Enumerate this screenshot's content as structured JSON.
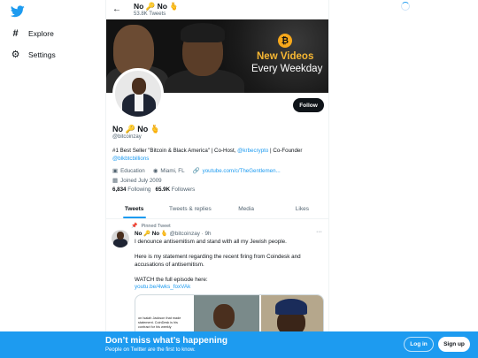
{
  "nav": {
    "logo_icon": "twitter-bird-icon",
    "items": [
      {
        "label": "Explore",
        "icon": "hashtag-icon"
      },
      {
        "label": "Settings",
        "icon": "gear-icon"
      }
    ]
  },
  "header": {
    "name": "No 🔑 No 🫰",
    "tweet_count": "53.8K Tweets"
  },
  "banner": {
    "line1": "New Videos",
    "line2": "Every Weekday"
  },
  "profile": {
    "name": "No 🔑 No 🫰",
    "handle": "@bitcoinzay",
    "bio_pre": "#1 Best Seller \"Bitcoin & Black America\" | Co-Host, ",
    "bio_link1": "@krbecrypto",
    "bio_mid": " | Co-Founder",
    "bio_link2": "@blkbtcbillions",
    "category": "Education",
    "location": "Miami, FL",
    "website": "youtube.com/c/TheGentlemen...",
    "joined": "Joined July 2009",
    "following_count": "6,834",
    "following_label": "Following",
    "followers_count": "65.9K",
    "followers_label": "Followers",
    "follow_button": "Follow"
  },
  "tabs": [
    "Tweets",
    "Tweets & replies",
    "Media",
    "Likes"
  ],
  "tweet": {
    "pinned_label": "Pinned Tweet",
    "name": "No 🔑 No 🫰",
    "handle": "@bitcoinzay",
    "time": "9h",
    "para1": "I denounce antisemitism and stand with all my Jewish people.",
    "para2": "Here is my statement regarding the recent firing from Coindesk and accusations of antisemitism.",
    "para3": "WATCH the full episode here:",
    "link": "youtu.be/4wks_foxVAk",
    "media_text": "on Isaiah Jackson that made statement. CoinDesk is his contract for his weekly"
  },
  "bottom_bar": {
    "title": "Don’t miss what’s happening",
    "subtitle": "People on Twitter are the first to know.",
    "login": "Log in",
    "signup": "Sign up"
  },
  "colors": {
    "accent": "#1d9bf0",
    "banner_gold": "#f7b733",
    "text": "#0f1419",
    "muted": "#536471"
  }
}
